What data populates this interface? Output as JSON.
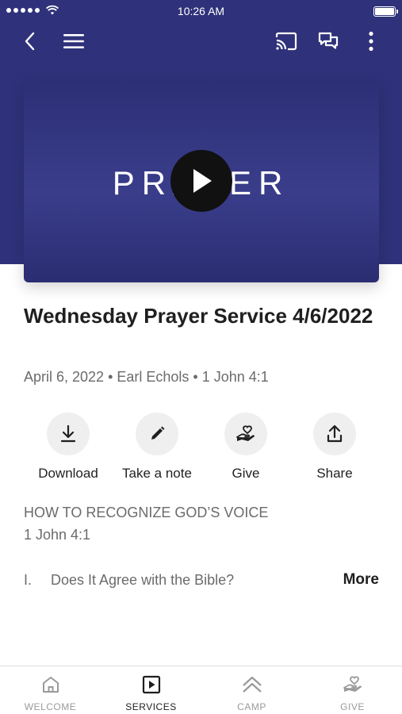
{
  "status_bar": {
    "time": "10:26 AM"
  },
  "header": {
    "back_icon": "chevron-left-icon",
    "menu_icon": "hamburger-menu-icon",
    "cast_icon": "cast-icon",
    "chat_icon": "chat-bubbles-icon",
    "more_icon": "more-vertical-icon",
    "background_color": "#2f327a"
  },
  "video": {
    "thumbnail_text": "PRAYER",
    "play_icon": "play-icon"
  },
  "sermon": {
    "title": "Wednesday Prayer Service 4/6/2022",
    "meta": "April 6, 2022 • Earl Echols • 1 John 4:1"
  },
  "actions": [
    {
      "label": "Download",
      "icon": "download-icon"
    },
    {
      "label": "Take a note",
      "icon": "pencil-icon"
    },
    {
      "label": "Give",
      "icon": "hand-heart-icon"
    },
    {
      "label": "Share",
      "icon": "share-icon"
    }
  ],
  "outline": {
    "heading": "HOW TO RECOGNIZE GOD’S VOICE",
    "reference": "1 John 4:1",
    "item_number": "I.",
    "item_text": "Does It Agree with the Bible?",
    "more_label": "More"
  },
  "tabs": [
    {
      "label": "WELCOME",
      "icon": "home-icon",
      "active": false
    },
    {
      "label": "SERVICES",
      "icon": "play-square-icon",
      "active": true
    },
    {
      "label": "CAMP",
      "icon": "chevrons-up-icon",
      "active": false
    },
    {
      "label": "GIVE",
      "icon": "hand-heart-icon",
      "active": false
    }
  ]
}
